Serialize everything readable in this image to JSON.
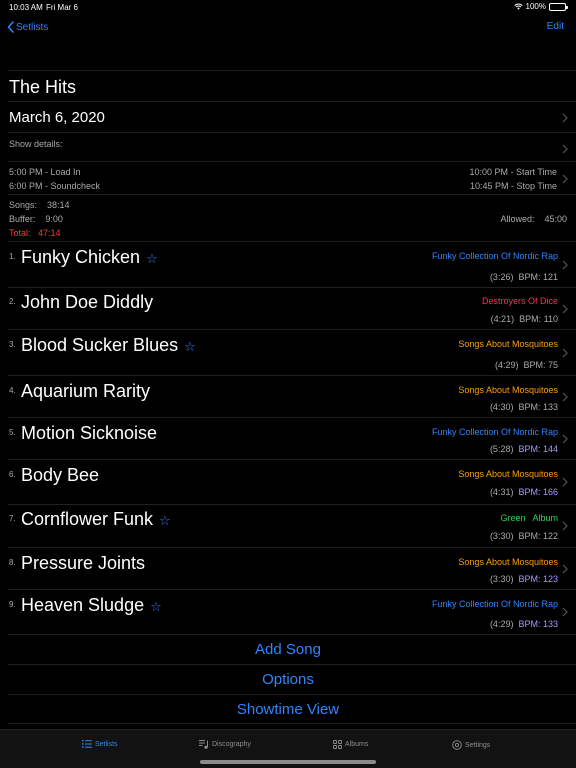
{
  "status_bar": {
    "time": "10:03 AM",
    "date": "Fri Mar 6",
    "battery": "100%"
  },
  "nav": {
    "back_label": "Setlists",
    "edit_label": "Edit"
  },
  "setlist": {
    "title": "The Hits",
    "date": "March 6, 2020",
    "show_details_label": "Show details:",
    "load_in": "5:00 PM - Load In",
    "soundcheck": "6:00 PM - Soundcheck",
    "start_time": "10:00 PM - Start Time",
    "stop_time": "10:45 PM - Stop Time",
    "songs_duration": "Songs:    38:14",
    "buffer_duration": "Buffer:    9:00",
    "total_duration": "Total:   47:14",
    "allowed_duration": "Allowed:    45:00"
  },
  "songs": [
    {
      "num": "1.",
      "name": "Funky Chicken",
      "star": "☆",
      "album": "Funky Collection Of Nordic Rap",
      "album_color": "#2f84ff",
      "duration": "(3:26)",
      "bpm": "BPM: 121"
    },
    {
      "num": "2.",
      "name": "John Doe Diddly",
      "star": "",
      "album": "Destroyers Of Dice",
      "album_color": "#ff2d55",
      "duration": "(4:21)",
      "bpm": "BPM: 110"
    },
    {
      "num": "3.",
      "name": "Blood Sucker Blues",
      "star": "☆",
      "album": "Songs About Mosquitoes",
      "album_color": "#ff9f0a",
      "duration": "(4:29)",
      "bpm": "BPM: 75"
    },
    {
      "num": "4.",
      "name": "Aquarium Rarity",
      "star": "",
      "album": "Songs About Mosquitoes",
      "album_color": "#ff9f0a",
      "duration": "(4:30)",
      "bpm": "BPM: 133"
    },
    {
      "num": "5.",
      "name": "Motion Sicknoise",
      "star": "",
      "album": "Funky Collection Of Nordic Rap",
      "album_color": "#2f84ff",
      "duration": "(5:28)",
      "bpm": "BPM: 144"
    },
    {
      "num": "6.",
      "name": "Body Bee",
      "star": "",
      "album": "Songs About Mosquitoes",
      "album_color": "#ff9f0a",
      "duration": "(4:31)",
      "bpm": "BPM: 166"
    },
    {
      "num": "7.",
      "name": "Cornflower Funk",
      "star": "☆",
      "album": "Green   Album",
      "album_color": "#30d158",
      "duration": "(3:30)",
      "bpm": "BPM: 122"
    },
    {
      "num": "8.",
      "name": "Pressure Joints",
      "star": "",
      "album": "Songs About Mosquitoes",
      "album_color": "#ff9f0a",
      "duration": "(3:30)",
      "bpm": "BPM: 123"
    },
    {
      "num": "9.",
      "name": "Heaven Sludge",
      "star": "☆",
      "album": "Funky Collection Of Nordic Rap",
      "album_color": "#2f84ff",
      "duration": "(4:29)",
      "bpm": "BPM: 133"
    }
  ],
  "actions": {
    "add_song": "Add Song",
    "options": "Options",
    "showtime_view": "Showtime View"
  },
  "tabs": [
    {
      "label": "Setlists",
      "icon": "list-icon",
      "active": true
    },
    {
      "label": "Discography",
      "icon": "music-notes-icon",
      "active": false
    },
    {
      "label": "Albums",
      "icon": "grid-icon",
      "active": false
    },
    {
      "label": "Settings",
      "icon": "gear-icon",
      "active": false
    }
  ],
  "colors": {
    "accent": "#2f84ff",
    "alert": "#ff3b30",
    "bpm_highlight": "#a998ff"
  }
}
